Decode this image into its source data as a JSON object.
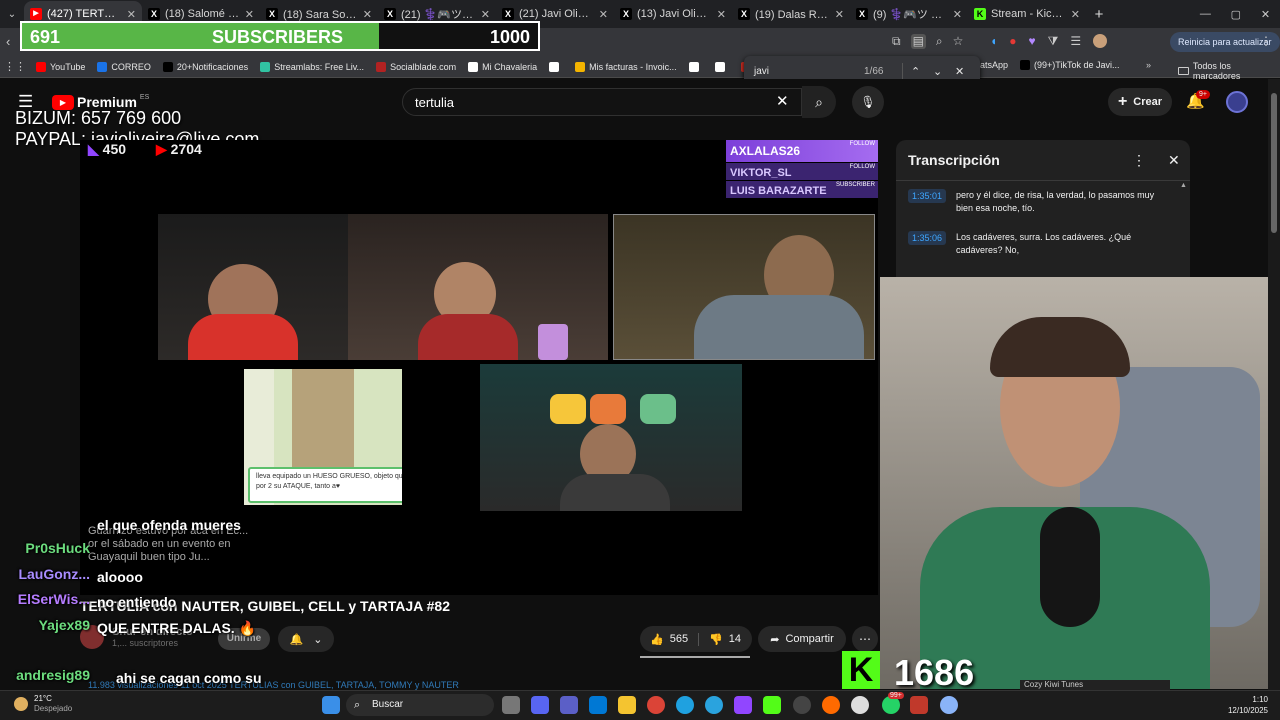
{
  "browser": {
    "tabs": [
      {
        "title": "(427) TERTULIA con N",
        "fav": "yt",
        "color": "#ff0000"
      },
      {
        "title": "(18) Salomé en X: \"",
        "fav": "X",
        "color": "#000000"
      },
      {
        "title": "(18) Sara Soriano🤍",
        "fav": "X",
        "color": "#000000"
      },
      {
        "title": "(21) ⚕️🎮ツ Friede ⊕",
        "fav": "X",
        "color": "#000000"
      },
      {
        "title": "(21) Javi Oliveira en X",
        "fav": "X",
        "color": "#000000"
      },
      {
        "title": "(13) Javi Oliveira en X",
        "fav": "X",
        "color": "#000000"
      },
      {
        "title": "(19) Dalas Review 📦",
        "fav": "X",
        "color": "#000000"
      },
      {
        "title": "(9) ⚕️🎮ツ Friede ⊕",
        "fav": "X",
        "color": "#000000"
      },
      {
        "title": "Stream - Kick Dashb",
        "fav": "K",
        "color": "#53fc18"
      }
    ],
    "new_tab": "+",
    "update_button": "Reinicia para actualizar",
    "bookmarks": [
      {
        "label": "YouTube",
        "color": "#ff0000"
      },
      {
        "label": "CORREO",
        "color": "#1a73e8"
      },
      {
        "label": "20+Notificaciones",
        "color": "#000000"
      },
      {
        "label": "Streamlabs: Free Liv...",
        "color": "#31c3a2"
      },
      {
        "label": "Socialblade.com",
        "color": "#b22222"
      },
      {
        "label": "Mi Chavaleria",
        "color": "#ffffff"
      },
      {
        "label": "",
        "color": "#ffffff"
      },
      {
        "label": "Mis facturas - Invoic...",
        "color": "#f4b400"
      },
      {
        "label": "",
        "color": "#ffffff"
      },
      {
        "label": "",
        "color": "#ffffff"
      },
      {
        "label": "Descargado",
        "color": "#d93025"
      }
    ],
    "bookmarks_right": [
      {
        "label": "atsApp",
        "color": "#25d366"
      },
      {
        "label": "(99+)TikTok de Javi...",
        "color": "#000000"
      }
    ],
    "all_bookmarks": "Todos los marcadores"
  },
  "overlay": {
    "subs_current": "691",
    "subs_label": "SUBSCRIBERS",
    "subs_goal": "1000",
    "subs_progress": 0.691,
    "bizum": "BIZUM: 657 769 600",
    "paypal": "PAYPAL: javioliveira@live.com",
    "kick_count": "1686",
    "kick_letter": "K",
    "music": "Cozy Kiwi Tunes"
  },
  "find": {
    "query": "javi",
    "count": "1/66"
  },
  "youtube": {
    "logo": "Premium",
    "region": "ES",
    "search_value": "tertulia",
    "create_label": "Crear",
    "notif_badge": "9+",
    "video_title": "TERTULIA con NAUTER, GUIBEL, CELL y TARTAJA #82",
    "channel_name": "Shur en directo",
    "subscribers": "1,... suscriptores",
    "join_label": "Unirme",
    "likes": "565",
    "dislikes": "14",
    "share_label": "Compartir",
    "description": "11.983 visualizaciones  11 oct 2025  TERTULIAS con GUIBEL, TARTAJA, TOMMY y NAUTER",
    "viewers_twitch": "450",
    "viewers_youtube": "2704",
    "alerts": [
      {
        "name": "AXLALAS26",
        "tag": "FOLLOW"
      },
      {
        "name": "VIKTOR_SL",
        "tag": "FOLLOW"
      },
      {
        "name": "LUIS BARAZARTE",
        "tag": "SUBSCRIBER"
      }
    ],
    "game_text": "lleva equipado un HUESO GRUESO, objeto que multiplica por 2 su ATAQUE, tanto a♥",
    "faded_comment": "Guarnizo estuvo por acá en Ec... or el sábado en un evento en Guayaquil buen tipo Ju..."
  },
  "chat": [
    {
      "user": "",
      "msg": "el que ofenda mueres",
      "color": "#ffffff"
    },
    {
      "user": "Pr0sHuck",
      "msg": "",
      "color": "#6cdc7e"
    },
    {
      "user": "LauGonz...",
      "msg": "aloooo",
      "color": "#a88cff"
    },
    {
      "user": "ElSerWis...",
      "msg": "no entiendo",
      "color": "#b57cff"
    },
    {
      "user": "Yajex89",
      "msg": "QUE ENTRE DALAS. 🔥",
      "color": "#6cdc7e"
    },
    {
      "user": "andresig89",
      "msg": "ahi se cagan como su idolo jajajaja",
      "color": "#6cdc7e"
    }
  ],
  "transcript": {
    "title": "Transcripción",
    "rows": [
      {
        "time": "1:35:01",
        "text": "pero y él dice, de risa, la verdad, lo pasamos muy bien esa noche, tío."
      },
      {
        "time": "1:35:06",
        "text": "Los cadáveres, surra. Los cadáveres. ¿Qué cadáveres? No,"
      }
    ]
  },
  "taskbar": {
    "weather_temp": "21°C",
    "weather_desc": "Despejado",
    "search_label": "Buscar",
    "time": "1:10",
    "date": "12/10/2025",
    "badge": "99+"
  }
}
